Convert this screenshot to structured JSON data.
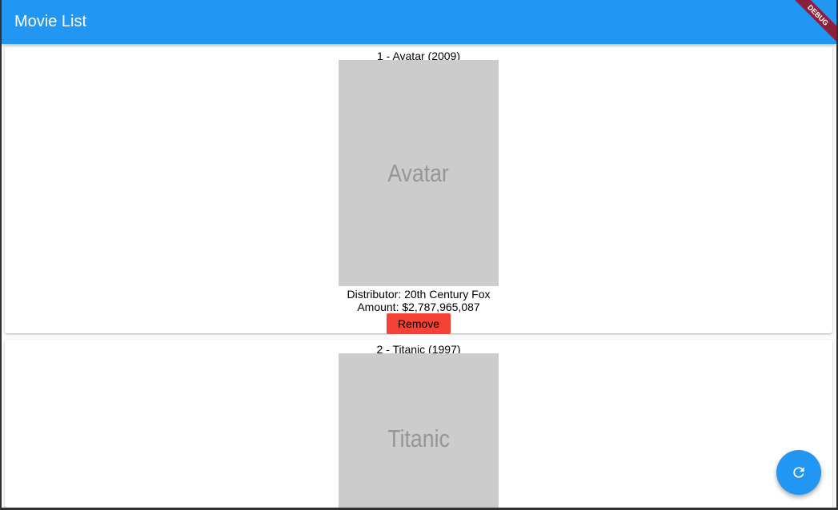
{
  "appbar": {
    "title": "Movie List",
    "debug_label": "DEBUG"
  },
  "movies": [
    {
      "title_line": "1 - Avatar (2009)",
      "poster_text": "Avatar",
      "distributor_line": "Distributor: 20th Century Fox",
      "amount_line": "Amount: $2,787,965,087",
      "remove_label": "Remove"
    },
    {
      "title_line": "2 - Titanic (1997)",
      "poster_text": "Titanic"
    }
  ],
  "fab": {
    "icon": "refresh-icon"
  },
  "colors": {
    "primary": "#2196f3",
    "remove": "#f44336",
    "poster_bg": "#cccccc",
    "debug_banner": "#8b1f3d"
  }
}
